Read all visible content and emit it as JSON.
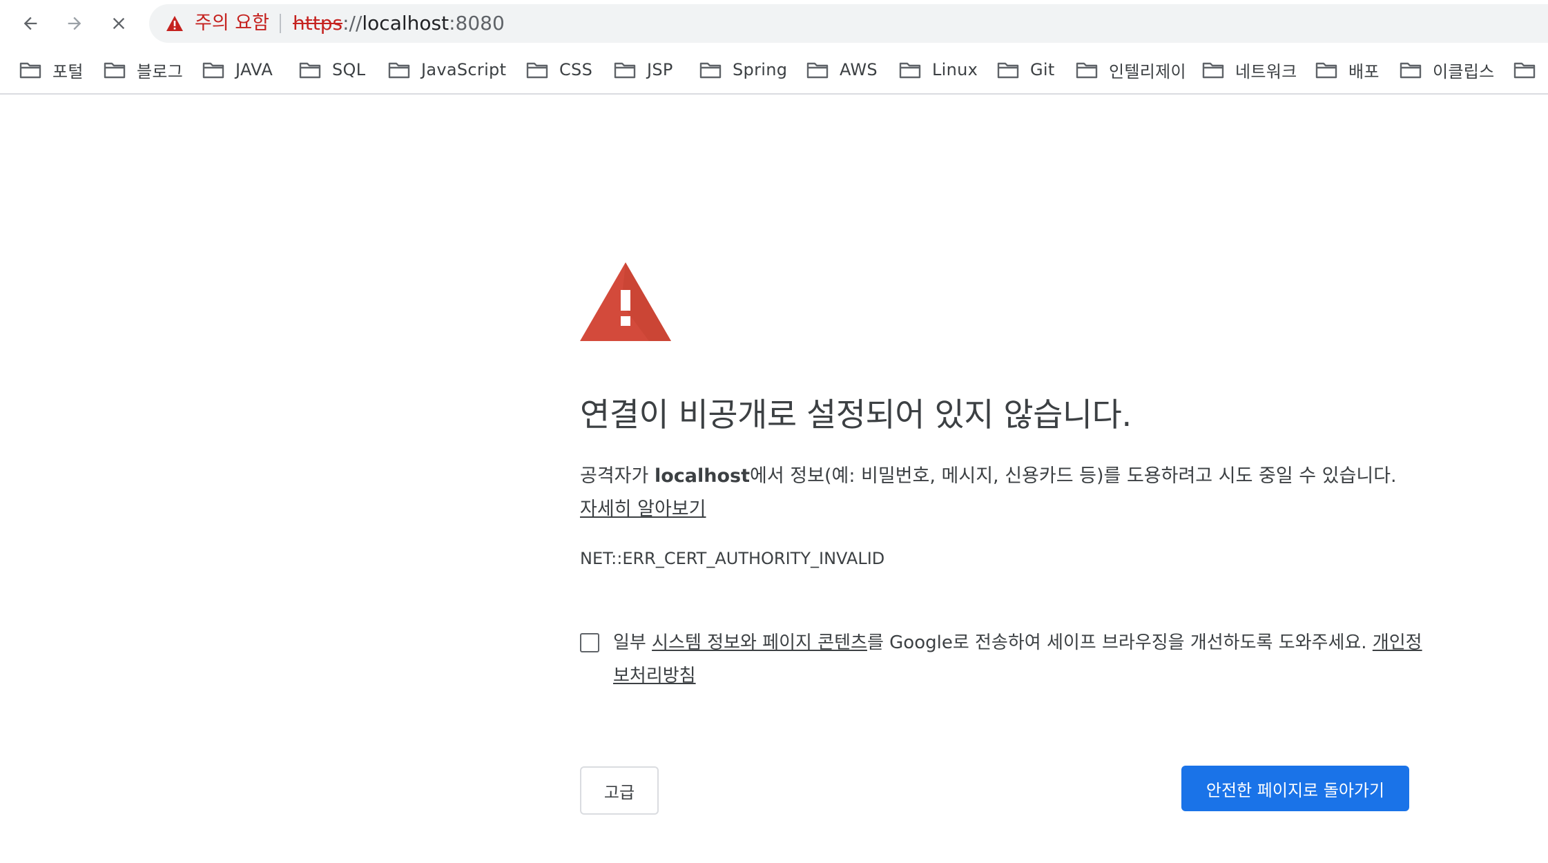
{
  "toolbar": {
    "back_icon": "arrow-left-icon",
    "forward_icon": "arrow-right-icon",
    "stop_icon": "close-icon",
    "security_icon": "warning-triangle-icon",
    "security_label": "주의 요함",
    "url_scheme": "https",
    "url_separator": "://",
    "url_host": "localhost",
    "url_port": ":8080"
  },
  "bookmarks": [
    {
      "label": "포털",
      "icon": "folder-icon"
    },
    {
      "label": "블로그",
      "icon": "folder-icon"
    },
    {
      "label": "JAVA",
      "icon": "folder-icon"
    },
    {
      "label": "SQL",
      "icon": "folder-icon"
    },
    {
      "label": "JavaScript",
      "icon": "folder-icon"
    },
    {
      "label": "CSS",
      "icon": "folder-icon"
    },
    {
      "label": "JSP",
      "icon": "folder-icon"
    },
    {
      "label": "Spring",
      "icon": "folder-icon"
    },
    {
      "label": "AWS",
      "icon": "folder-icon"
    },
    {
      "label": "Linux",
      "icon": "folder-icon"
    },
    {
      "label": "Git",
      "icon": "folder-icon"
    },
    {
      "label": "인텔리제이",
      "icon": "folder-icon"
    },
    {
      "label": "네트워크",
      "icon": "folder-icon"
    },
    {
      "label": "배포",
      "icon": "folder-icon"
    },
    {
      "label": "이클립스",
      "icon": "folder-icon"
    },
    {
      "label": "",
      "icon": "folder-icon"
    }
  ],
  "interstitial": {
    "icon": "warning-triangle-icon",
    "heading": "연결이 비공개로 설정되어 있지 않습니다.",
    "explanation_prefix": "공격자가 ",
    "explanation_host": "localhost",
    "explanation_suffix": "에서 정보(예: 비밀번호, 메시지, 신용카드 등)를 도용하려고 시도 중일 수 있습니다. ",
    "learn_more_link": "자세히 알아보기",
    "error_code": "NET::ERR_CERT_AUTHORITY_INVALID",
    "optin_prefix": "일부 ",
    "optin_link": "시스템 정보와 페이지 콘텐츠",
    "optin_middle": "를 Google로 전송하여 세이프 브라우징을 개선하도록 도와주세요. ",
    "privacy_link": "개인정보처리방침",
    "advanced_button": "고급",
    "back_to_safety_button": "안전한 페이지로 돌아가기"
  },
  "colors": {
    "warning_red": "#d34a3b",
    "primary_blue": "#1a73e8",
    "omnibox_bg": "#f1f3f4"
  }
}
